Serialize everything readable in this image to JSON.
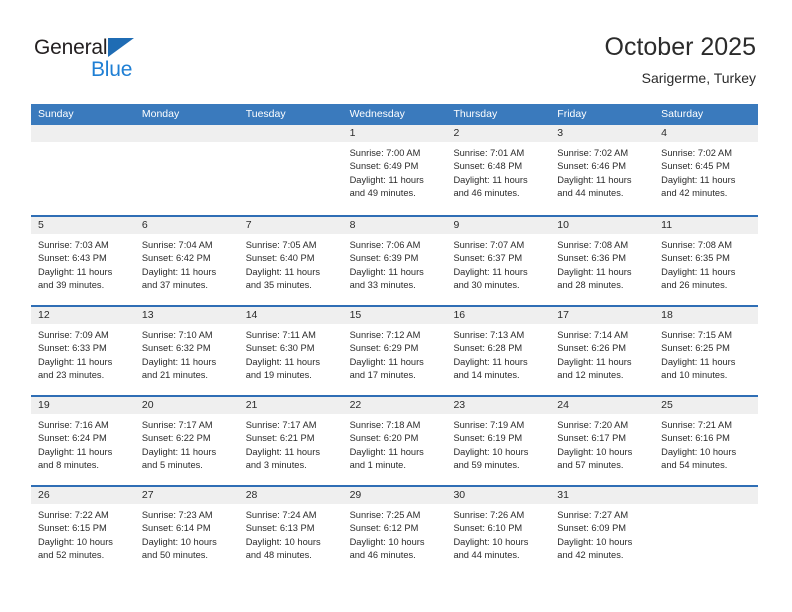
{
  "brand": {
    "name_dark": "General",
    "name_blue": "Blue",
    "accent_color": "#1f7fd4",
    "triangle_color": "#1f6cb4"
  },
  "header": {
    "title": "October 2025",
    "subtitle": "Sarigerme, Turkey"
  },
  "colors": {
    "header_row_bg": "#3a7abd",
    "week_divider": "#2f6eb5",
    "daynum_bg": "#efefef",
    "text": "#2b2b2b"
  },
  "calendar": {
    "day_headers": [
      "Sunday",
      "Monday",
      "Tuesday",
      "Wednesday",
      "Thursday",
      "Friday",
      "Saturday"
    ],
    "weeks": [
      [
        {
          "day": "",
          "sunrise": "",
          "sunset": "",
          "daylight_1": "",
          "daylight_2": ""
        },
        {
          "day": "",
          "sunrise": "",
          "sunset": "",
          "daylight_1": "",
          "daylight_2": ""
        },
        {
          "day": "",
          "sunrise": "",
          "sunset": "",
          "daylight_1": "",
          "daylight_2": ""
        },
        {
          "day": "1",
          "sunrise": "Sunrise: 7:00 AM",
          "sunset": "Sunset: 6:49 PM",
          "daylight_1": "Daylight: 11 hours",
          "daylight_2": "and 49 minutes."
        },
        {
          "day": "2",
          "sunrise": "Sunrise: 7:01 AM",
          "sunset": "Sunset: 6:48 PM",
          "daylight_1": "Daylight: 11 hours",
          "daylight_2": "and 46 minutes."
        },
        {
          "day": "3",
          "sunrise": "Sunrise: 7:02 AM",
          "sunset": "Sunset: 6:46 PM",
          "daylight_1": "Daylight: 11 hours",
          "daylight_2": "and 44 minutes."
        },
        {
          "day": "4",
          "sunrise": "Sunrise: 7:02 AM",
          "sunset": "Sunset: 6:45 PM",
          "daylight_1": "Daylight: 11 hours",
          "daylight_2": "and 42 minutes."
        }
      ],
      [
        {
          "day": "5",
          "sunrise": "Sunrise: 7:03 AM",
          "sunset": "Sunset: 6:43 PM",
          "daylight_1": "Daylight: 11 hours",
          "daylight_2": "and 39 minutes."
        },
        {
          "day": "6",
          "sunrise": "Sunrise: 7:04 AM",
          "sunset": "Sunset: 6:42 PM",
          "daylight_1": "Daylight: 11 hours",
          "daylight_2": "and 37 minutes."
        },
        {
          "day": "7",
          "sunrise": "Sunrise: 7:05 AM",
          "sunset": "Sunset: 6:40 PM",
          "daylight_1": "Daylight: 11 hours",
          "daylight_2": "and 35 minutes."
        },
        {
          "day": "8",
          "sunrise": "Sunrise: 7:06 AM",
          "sunset": "Sunset: 6:39 PM",
          "daylight_1": "Daylight: 11 hours",
          "daylight_2": "and 33 minutes."
        },
        {
          "day": "9",
          "sunrise": "Sunrise: 7:07 AM",
          "sunset": "Sunset: 6:37 PM",
          "daylight_1": "Daylight: 11 hours",
          "daylight_2": "and 30 minutes."
        },
        {
          "day": "10",
          "sunrise": "Sunrise: 7:08 AM",
          "sunset": "Sunset: 6:36 PM",
          "daylight_1": "Daylight: 11 hours",
          "daylight_2": "and 28 minutes."
        },
        {
          "day": "11",
          "sunrise": "Sunrise: 7:08 AM",
          "sunset": "Sunset: 6:35 PM",
          "daylight_1": "Daylight: 11 hours",
          "daylight_2": "and 26 minutes."
        }
      ],
      [
        {
          "day": "12",
          "sunrise": "Sunrise: 7:09 AM",
          "sunset": "Sunset: 6:33 PM",
          "daylight_1": "Daylight: 11 hours",
          "daylight_2": "and 23 minutes."
        },
        {
          "day": "13",
          "sunrise": "Sunrise: 7:10 AM",
          "sunset": "Sunset: 6:32 PM",
          "daylight_1": "Daylight: 11 hours",
          "daylight_2": "and 21 minutes."
        },
        {
          "day": "14",
          "sunrise": "Sunrise: 7:11 AM",
          "sunset": "Sunset: 6:30 PM",
          "daylight_1": "Daylight: 11 hours",
          "daylight_2": "and 19 minutes."
        },
        {
          "day": "15",
          "sunrise": "Sunrise: 7:12 AM",
          "sunset": "Sunset: 6:29 PM",
          "daylight_1": "Daylight: 11 hours",
          "daylight_2": "and 17 minutes."
        },
        {
          "day": "16",
          "sunrise": "Sunrise: 7:13 AM",
          "sunset": "Sunset: 6:28 PM",
          "daylight_1": "Daylight: 11 hours",
          "daylight_2": "and 14 minutes."
        },
        {
          "day": "17",
          "sunrise": "Sunrise: 7:14 AM",
          "sunset": "Sunset: 6:26 PM",
          "daylight_1": "Daylight: 11 hours",
          "daylight_2": "and 12 minutes."
        },
        {
          "day": "18",
          "sunrise": "Sunrise: 7:15 AM",
          "sunset": "Sunset: 6:25 PM",
          "daylight_1": "Daylight: 11 hours",
          "daylight_2": "and 10 minutes."
        }
      ],
      [
        {
          "day": "19",
          "sunrise": "Sunrise: 7:16 AM",
          "sunset": "Sunset: 6:24 PM",
          "daylight_1": "Daylight: 11 hours",
          "daylight_2": "and 8 minutes."
        },
        {
          "day": "20",
          "sunrise": "Sunrise: 7:17 AM",
          "sunset": "Sunset: 6:22 PM",
          "daylight_1": "Daylight: 11 hours",
          "daylight_2": "and 5 minutes."
        },
        {
          "day": "21",
          "sunrise": "Sunrise: 7:17 AM",
          "sunset": "Sunset: 6:21 PM",
          "daylight_1": "Daylight: 11 hours",
          "daylight_2": "and 3 minutes."
        },
        {
          "day": "22",
          "sunrise": "Sunrise: 7:18 AM",
          "sunset": "Sunset: 6:20 PM",
          "daylight_1": "Daylight: 11 hours",
          "daylight_2": "and 1 minute."
        },
        {
          "day": "23",
          "sunrise": "Sunrise: 7:19 AM",
          "sunset": "Sunset: 6:19 PM",
          "daylight_1": "Daylight: 10 hours",
          "daylight_2": "and 59 minutes."
        },
        {
          "day": "24",
          "sunrise": "Sunrise: 7:20 AM",
          "sunset": "Sunset: 6:17 PM",
          "daylight_1": "Daylight: 10 hours",
          "daylight_2": "and 57 minutes."
        },
        {
          "day": "25",
          "sunrise": "Sunrise: 7:21 AM",
          "sunset": "Sunset: 6:16 PM",
          "daylight_1": "Daylight: 10 hours",
          "daylight_2": "and 54 minutes."
        }
      ],
      [
        {
          "day": "26",
          "sunrise": "Sunrise: 7:22 AM",
          "sunset": "Sunset: 6:15 PM",
          "daylight_1": "Daylight: 10 hours",
          "daylight_2": "and 52 minutes."
        },
        {
          "day": "27",
          "sunrise": "Sunrise: 7:23 AM",
          "sunset": "Sunset: 6:14 PM",
          "daylight_1": "Daylight: 10 hours",
          "daylight_2": "and 50 minutes."
        },
        {
          "day": "28",
          "sunrise": "Sunrise: 7:24 AM",
          "sunset": "Sunset: 6:13 PM",
          "daylight_1": "Daylight: 10 hours",
          "daylight_2": "and 48 minutes."
        },
        {
          "day": "29",
          "sunrise": "Sunrise: 7:25 AM",
          "sunset": "Sunset: 6:12 PM",
          "daylight_1": "Daylight: 10 hours",
          "daylight_2": "and 46 minutes."
        },
        {
          "day": "30",
          "sunrise": "Sunrise: 7:26 AM",
          "sunset": "Sunset: 6:10 PM",
          "daylight_1": "Daylight: 10 hours",
          "daylight_2": "and 44 minutes."
        },
        {
          "day": "31",
          "sunrise": "Sunrise: 7:27 AM",
          "sunset": "Sunset: 6:09 PM",
          "daylight_1": "Daylight: 10 hours",
          "daylight_2": "and 42 minutes."
        },
        {
          "day": "",
          "sunrise": "",
          "sunset": "",
          "daylight_1": "",
          "daylight_2": ""
        }
      ]
    ]
  }
}
